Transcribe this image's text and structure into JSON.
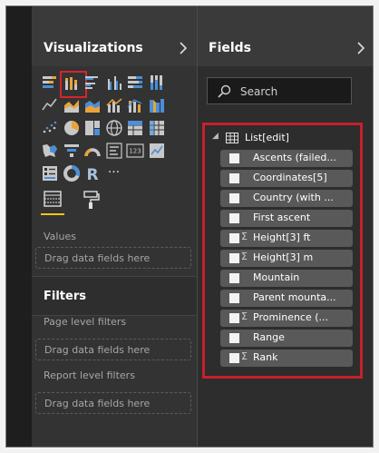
{
  "visualizations": {
    "title": "Visualizations",
    "icons": [
      {
        "name": "stacked-bar-chart-icon"
      },
      {
        "name": "stacked-column-chart-icon",
        "selected": true
      },
      {
        "name": "clustered-bar-chart-icon"
      },
      {
        "name": "clustered-column-chart-icon"
      },
      {
        "name": "100-stacked-bar-chart-icon"
      },
      {
        "name": "100-stacked-column-chart-icon"
      },
      {
        "name": "blank"
      },
      {
        "name": "line-chart-icon"
      },
      {
        "name": "area-chart-icon"
      },
      {
        "name": "stacked-area-chart-icon"
      },
      {
        "name": "line-and-column-chart-icon"
      },
      {
        "name": "line-and-stacked-column-chart-icon"
      },
      {
        "name": "ribbon-chart-icon"
      },
      {
        "name": "blank"
      },
      {
        "name": "scatter-chart-icon"
      },
      {
        "name": "pie-chart-icon"
      },
      {
        "name": "treemap-icon"
      },
      {
        "name": "map-icon"
      },
      {
        "name": "table-icon"
      },
      {
        "name": "matrix-icon"
      },
      {
        "name": "blank"
      },
      {
        "name": "filled-map-icon"
      },
      {
        "name": "funnel-icon"
      },
      {
        "name": "gauge-icon"
      },
      {
        "name": "multi-row-card-icon"
      },
      {
        "name": "card-icon"
      },
      {
        "name": "kpi-icon"
      },
      {
        "name": "blank"
      },
      {
        "name": "slicer-icon"
      },
      {
        "name": "donut-chart-icon"
      },
      {
        "name": "r-script-visual-icon"
      },
      {
        "name": "more-visuals-icon"
      }
    ],
    "card_text": "123",
    "r_text": "R",
    "more_text": "···",
    "values_label": "Values",
    "values_drop": "Drag data fields here"
  },
  "filters": {
    "title": "Filters",
    "page_label": "Page level filters",
    "page_drop": "Drag data fields here",
    "report_label": "Report level filters",
    "report_drop": "Drag data fields here"
  },
  "fields": {
    "title": "Fields",
    "search_placeholder": "Search",
    "table_name": "List[edit]",
    "items": [
      {
        "label": "Ascents (failed...",
        "sigma": false
      },
      {
        "label": "Coordinates[5]",
        "sigma": false
      },
      {
        "label": "Country (with ...",
        "sigma": false
      },
      {
        "label": "First ascent",
        "sigma": false
      },
      {
        "label": "Height[3] ft",
        "sigma": true
      },
      {
        "label": "Height[3] m",
        "sigma": true
      },
      {
        "label": "Mountain",
        "sigma": false
      },
      {
        "label": "Parent mounta...",
        "sigma": false
      },
      {
        "label": "Prominence (...",
        "sigma": true
      },
      {
        "label": "Range",
        "sigma": false
      },
      {
        "label": "Rank",
        "sigma": true
      }
    ],
    "sigma_symbol": "Σ"
  },
  "colors": {
    "highlight_border": "#c8202a",
    "active_tab_underline": "#f2c811",
    "icon_blue": "#4a8fd8",
    "icon_orange": "#e8a33d",
    "icon_gray": "#c8c8c8"
  }
}
